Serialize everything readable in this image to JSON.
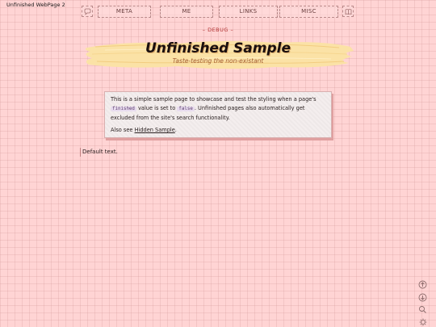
{
  "window": {
    "title": "Unfinished WebPage 2"
  },
  "nav": {
    "items": [
      {
        "label": "META"
      },
      {
        "label": "ME"
      },
      {
        "label": "LINKS"
      },
      {
        "label": "MISC"
      }
    ]
  },
  "debug_label": "– DEBUG –",
  "header": {
    "title": "Unfinished Sample",
    "subtitle": "Taste-testing the non-existant"
  },
  "notice": {
    "text_1": "This is a simple sample page to showcase and test the styling when a page's ",
    "code_1": "finished",
    "text_2": " value is set to ",
    "code_2": "false",
    "text_3": ". Unfinished pages also automatically get excluded from the site's search functionality.",
    "see_also_prefix": "Also see ",
    "see_also_link": "Hidden Sample",
    "see_also_suffix": "."
  },
  "content": {
    "default_text": "Default text."
  },
  "colors": {
    "background": "#ffd4d4",
    "banner": "#fbe2a6",
    "debug": "#b03030",
    "subtitle": "#a05a30"
  },
  "icons": {
    "nav_left": "speech-bubble-icon",
    "nav_right": "book-icon",
    "side_tools": [
      "scroll-up-icon",
      "scroll-down-icon",
      "search-icon",
      "settings-icon"
    ]
  }
}
